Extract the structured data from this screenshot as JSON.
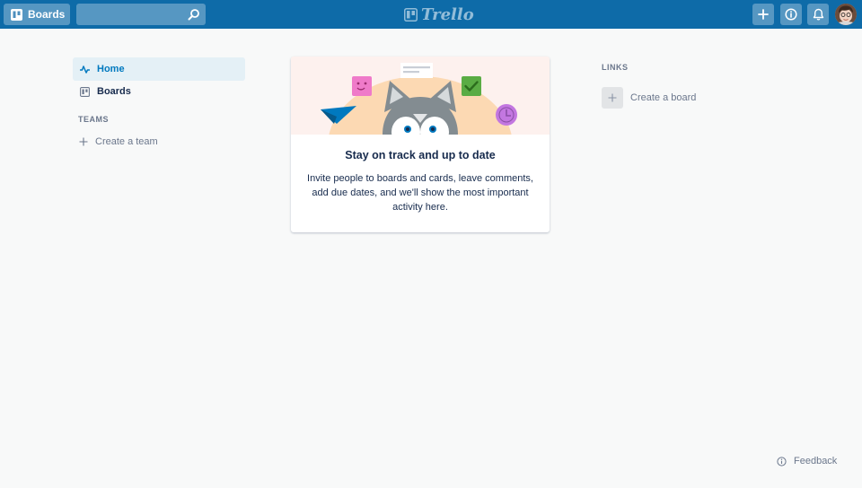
{
  "header": {
    "boards_label": "Boards",
    "search_placeholder": "",
    "logo_text": "Trello",
    "add_icon": "plus-icon",
    "info_icon": "info-icon",
    "notifications_icon": "bell-icon",
    "brand_color": "#0e6ba8"
  },
  "sidebar": {
    "items": [
      {
        "label": "Home",
        "icon": "activity-icon",
        "active": true
      },
      {
        "label": "Boards",
        "icon": "board-icon",
        "active": false
      }
    ],
    "teams_title": "TEAMS",
    "create_team_label": "Create a team",
    "accent_color": "#0079bf"
  },
  "main": {
    "card_title": "Stay on track and up to date",
    "card_text": "Invite people to boards and cards, leave comments, add due dates, and we'll show the most important activity here."
  },
  "links": {
    "title": "LINKS",
    "create_board_label": "Create a board"
  },
  "footer": {
    "feedback_label": "Feedback"
  }
}
